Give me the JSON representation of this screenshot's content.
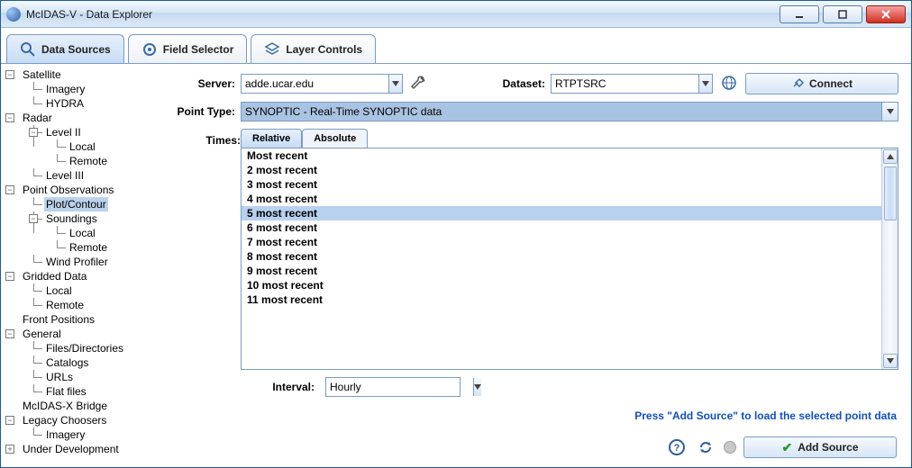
{
  "window": {
    "title": "McIDAS-V - Data Explorer"
  },
  "tabs": {
    "dataSources": "Data Sources",
    "fieldSelector": "Field Selector",
    "layerControls": "Layer Controls"
  },
  "tree": {
    "satellite": "Satellite",
    "imagery": "Imagery",
    "hydra": "HYDRA",
    "radar": "Radar",
    "level2": "Level II",
    "local": "Local",
    "remote": "Remote",
    "level3": "Level III",
    "pointObs": "Point Observations",
    "plotContour": "Plot/Contour",
    "soundings": "Soundings",
    "windProfiler": "Wind Profiler",
    "gridded": "Gridded Data",
    "frontPositions": "Front Positions",
    "general": "General",
    "filesDirs": "Files/Directories",
    "catalogs": "Catalogs",
    "urls": "URLs",
    "flatFiles": "Flat files",
    "mcidasx": "McIDAS-X Bridge",
    "legacy": "Legacy Choosers",
    "underDev": "Under Development"
  },
  "labels": {
    "server": "Server:",
    "dataset": "Dataset:",
    "pointType": "Point Type:",
    "times": "Times:",
    "relative": "Relative",
    "absolute": "Absolute",
    "interval": "Interval:",
    "connect": "Connect",
    "addSource": "Add Source",
    "hint": "Press \"Add Source\" to load the selected point data"
  },
  "values": {
    "server": "adde.ucar.edu",
    "dataset": "RTPTSRC",
    "pointType": "SYNOPTIC - Real-Time SYNOPTIC data",
    "interval": "Hourly",
    "selectedTimeIndex": 4
  },
  "timesList": [
    "Most recent",
    "2 most recent",
    "3 most recent",
    "4 most recent",
    "5 most recent",
    "6 most recent",
    "7 most recent",
    "8 most recent",
    "9 most recent",
    "10 most recent",
    "11 most recent"
  ]
}
